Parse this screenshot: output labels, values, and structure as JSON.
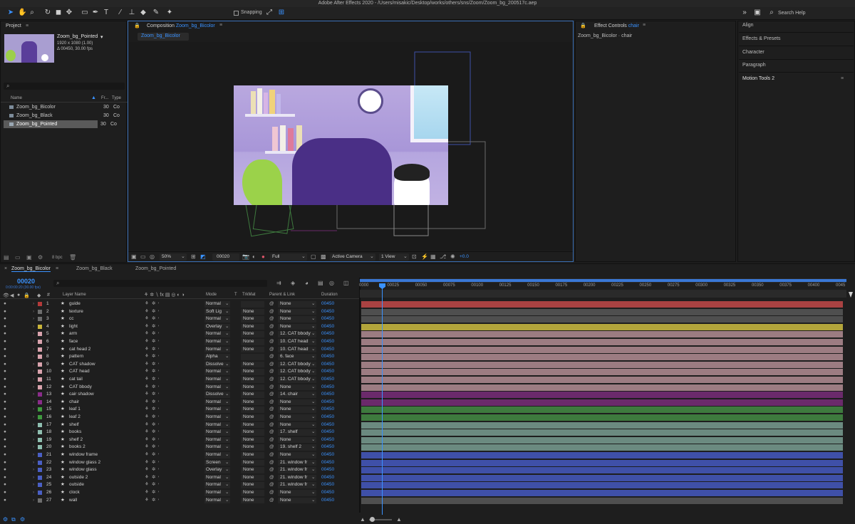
{
  "window": {
    "title": "Adobe After Effects 2020 - /Users/misakic/Desktop/works/others/sns/Zoom/Zoom_bg_200517c.aep"
  },
  "toolbar": {
    "snapping_label": "Snapping",
    "search_placeholder": "Search Help"
  },
  "project": {
    "panel_label": "Project",
    "selected_name": "Zoom_bg_Pointed",
    "selected_info1": "1920 x 1080 (1.00)",
    "selected_info2": "Δ 00450, 30.00 fps",
    "col_name": "Name",
    "col_fr": "Fr...",
    "col_type": "Type",
    "items": [
      {
        "name": "Zoom_bg_Bicolor",
        "fr": "30",
        "type": "Co"
      },
      {
        "name": "Zoom_bg_Black",
        "fr": "30",
        "type": "Co"
      },
      {
        "name": "Zoom_bg_Pointed",
        "fr": "30",
        "type": "Co"
      }
    ],
    "bpc": "8 bpc"
  },
  "composition": {
    "panel_label": "Composition",
    "name": "Zoom_bg_Bicolor",
    "tab_name": "Zoom_bg_Bicolor",
    "zoom": "50%",
    "timecode": "00020",
    "resolution": "Full",
    "camera": "Active Camera",
    "view": "1 View",
    "exposure": "+0.0"
  },
  "effect_controls": {
    "label": "Effect Controls",
    "layer": "chair",
    "subtitle": "Zoom_bg_Bicolor · chair"
  },
  "workspaces": [
    "Align",
    "Effects & Presets",
    "Character",
    "Paragraph",
    "Motion Tools 2"
  ],
  "timeline": {
    "tabs": [
      "Zoom_bg_Bicolor",
      "Zoom_bg_Black",
      "Zoom_bg_Pointed"
    ],
    "current_time": "00020",
    "current_time_sub": "0:00:00:20 (30.00 fps)",
    "headers": {
      "layer_name": "Layer Name",
      "mode": "Mode",
      "t": "T",
      "trkmat": "TrkMat",
      "parent": "Parent & Link",
      "duration": "Duration"
    },
    "ruler": [
      "0000",
      "00025",
      "00050",
      "00075",
      "00100",
      "00125",
      "00150",
      "00175",
      "00200",
      "00225",
      "00250",
      "00275",
      "00300",
      "00325",
      "00350",
      "00375",
      "00400",
      "0045"
    ],
    "layers": [
      {
        "num": "1",
        "name": "guide",
        "mode": "Normal",
        "trkmat": "",
        "parent": "None",
        "dur": "00450",
        "color": "#b33a3a",
        "track": "#a94242"
      },
      {
        "num": "2",
        "name": "texture",
        "mode": "Soft Lig",
        "trkmat": "None",
        "parent": "None",
        "dur": "00450",
        "color": "#6e6e6e",
        "track": "#4f4f4f"
      },
      {
        "num": "3",
        "name": "cc",
        "mode": "Normal",
        "trkmat": "None",
        "parent": "None",
        "dur": "00450",
        "color": "#6e6e6e",
        "track": "#4f4f4f"
      },
      {
        "num": "4",
        "name": "light",
        "mode": "Overlay",
        "trkmat": "None",
        "parent": "None",
        "dur": "00450",
        "color": "#c9b53a",
        "track": "#b3a53b"
      },
      {
        "num": "5",
        "name": "arm",
        "mode": "Normal",
        "trkmat": "None",
        "parent": "12. CAT bbody",
        "dur": "00450",
        "color": "#d9a3ad",
        "track": "#9c7c82"
      },
      {
        "num": "6",
        "name": "face",
        "mode": "Normal",
        "trkmat": "None",
        "parent": "10. CAT head",
        "dur": "00450",
        "color": "#d9a3ad",
        "track": "#9c7c82"
      },
      {
        "num": "7",
        "name": "cat head 2",
        "mode": "Normal",
        "trkmat": "None",
        "parent": "10. CAT head",
        "dur": "00450",
        "color": "#d9a3ad",
        "track": "#9c7c82"
      },
      {
        "num": "8",
        "name": "pattern",
        "mode": "Alpha",
        "trkmat": "",
        "parent": "6. face",
        "dur": "00450",
        "color": "#d9a3ad",
        "track": "#9c7c82"
      },
      {
        "num": "9",
        "name": "CAT shadow",
        "mode": "Dissolve",
        "trkmat": "None",
        "parent": "12. CAT bbody",
        "dur": "00450",
        "color": "#d9a3ad",
        "track": "#9c7c82"
      },
      {
        "num": "10",
        "name": "CAT head",
        "mode": "Normal",
        "trkmat": "None",
        "parent": "12. CAT bbody",
        "dur": "00450",
        "color": "#d9a3ad",
        "track": "#9c7c82"
      },
      {
        "num": "11",
        "name": "cat tail",
        "mode": "Normal",
        "trkmat": "None",
        "parent": "12. CAT bbody",
        "dur": "00450",
        "color": "#d9a3ad",
        "track": "#9c7c82"
      },
      {
        "num": "12",
        "name": "CAT bbody",
        "mode": "Normal",
        "trkmat": "None",
        "parent": "None",
        "dur": "00450",
        "color": "#d9a3ad",
        "track": "#9c7c82"
      },
      {
        "num": "13",
        "name": "cair shadow",
        "mode": "Dissolve",
        "trkmat": "None",
        "parent": "14. chair",
        "dur": "00450",
        "color": "#8a2c8a",
        "track": "#6b2a6b"
      },
      {
        "num": "14",
        "name": "chair",
        "mode": "Normal",
        "trkmat": "None",
        "parent": "None",
        "dur": "00450",
        "color": "#8a2c8a",
        "track": "#6b2a6b"
      },
      {
        "num": "15",
        "name": "leaf 1",
        "mode": "Normal",
        "trkmat": "None",
        "parent": "None",
        "dur": "00450",
        "color": "#3f9a3f",
        "track": "#3e7a3e"
      },
      {
        "num": "16",
        "name": "leaf 2",
        "mode": "Normal",
        "trkmat": "None",
        "parent": "None",
        "dur": "00450",
        "color": "#3f9a3f",
        "track": "#3e7a3e"
      },
      {
        "num": "17",
        "name": "shelf",
        "mode": "Normal",
        "trkmat": "None",
        "parent": "None",
        "dur": "00450",
        "color": "#8fbfb0",
        "track": "#6b8a80"
      },
      {
        "num": "18",
        "name": "books",
        "mode": "Normal",
        "trkmat": "None",
        "parent": "17. shelf",
        "dur": "00450",
        "color": "#8fbfb0",
        "track": "#6b8a80"
      },
      {
        "num": "19",
        "name": "shelf 2",
        "mode": "Normal",
        "trkmat": "None",
        "parent": "None",
        "dur": "00450",
        "color": "#8fbfb0",
        "track": "#6b8a80"
      },
      {
        "num": "20",
        "name": "books 2",
        "mode": "Normal",
        "trkmat": "None",
        "parent": "19. shelf 2",
        "dur": "00450",
        "color": "#8fbfb0",
        "track": "#6b8a80"
      },
      {
        "num": "21",
        "name": "window frame",
        "mode": "Normal",
        "trkmat": "None",
        "parent": "None",
        "dur": "00450",
        "color": "#4a5fc4",
        "track": "#3f50a8"
      },
      {
        "num": "22",
        "name": "window glass 2",
        "mode": "Screen",
        "trkmat": "None",
        "parent": "21. window fr",
        "dur": "00450",
        "color": "#4a5fc4",
        "track": "#3f50a8"
      },
      {
        "num": "23",
        "name": "window glass",
        "mode": "Overlay",
        "trkmat": "None",
        "parent": "21. window fr",
        "dur": "00450",
        "color": "#4a5fc4",
        "track": "#3f50a8"
      },
      {
        "num": "24",
        "name": "outside 2",
        "mode": "Normal",
        "trkmat": "None",
        "parent": "21. window fr",
        "dur": "00450",
        "color": "#4a5fc4",
        "track": "#3f50a8"
      },
      {
        "num": "25",
        "name": "outside",
        "mode": "Normal",
        "trkmat": "None",
        "parent": "21. window fr",
        "dur": "00450",
        "color": "#4a5fc4",
        "track": "#3f50a8"
      },
      {
        "num": "26",
        "name": "clock",
        "mode": "Normal",
        "trkmat": "None",
        "parent": "None",
        "dur": "00450",
        "color": "#4a5fc4",
        "track": "#3f50a8"
      },
      {
        "num": "27",
        "name": "wall",
        "mode": "Normal",
        "trkmat": "None",
        "parent": "None",
        "dur": "00450",
        "color": "#6e6e6e",
        "track": "#4f4f4f"
      }
    ]
  }
}
